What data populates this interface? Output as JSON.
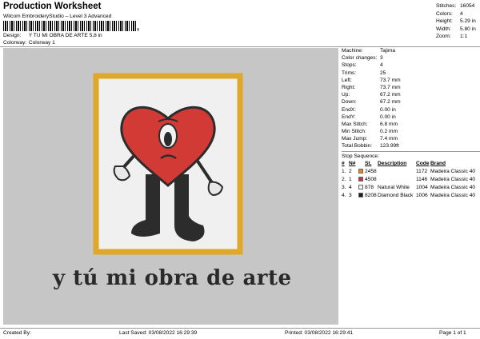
{
  "header": {
    "title": "Production Worksheet",
    "subtitle": "Wilcom EmbroideryStudio – Level 3 Advanced",
    "barcode_tail": ",",
    "design_label": "Design:",
    "design_value": "Y TU MI OBRA DE ARTE 5,8 in",
    "colorway_label": "Colorway:",
    "colorway_value": "Colorway 1"
  },
  "summary": [
    {
      "label": "Stitches:",
      "value": "16054"
    },
    {
      "label": "Colors:",
      "value": "4"
    },
    {
      "label": "Height:",
      "value": "5.29 in"
    },
    {
      "label": "Width:",
      "value": "5.80 in"
    },
    {
      "label": "Zoom:",
      "value": "1:1"
    }
  ],
  "design": {
    "text": "y tú mi obra de arte",
    "colors": {
      "background": "#c6c6c6",
      "frame": "#e0a82a",
      "frame_fill": "#f0f0f0",
      "heart": "#d23a35",
      "body": "#2c2c2c",
      "eye": "#f2f2f2"
    }
  },
  "machine": [
    {
      "label": "Machine:",
      "value": "Tajima"
    },
    {
      "label": "Color changes:",
      "value": "3"
    },
    {
      "label": "Stops:",
      "value": "4"
    },
    {
      "label": "Trims:",
      "value": "25"
    },
    {
      "label": "Left:",
      "value": "73.7 mm"
    },
    {
      "label": "Right:",
      "value": "73.7 mm"
    },
    {
      "label": "Up:",
      "value": "67.2 mm"
    },
    {
      "label": "Down:",
      "value": "67.2 mm"
    },
    {
      "label": "EndX:",
      "value": "0.00 in"
    },
    {
      "label": "EndY:",
      "value": "0.00 in"
    },
    {
      "label": "Max Stitch:",
      "value": "6.8 mm"
    },
    {
      "label": "Min Stitch:",
      "value": "0.2 mm"
    },
    {
      "label": "Max Jump:",
      "value": "7.4 mm"
    },
    {
      "label": "Total Bobbin:",
      "value": "123.99ft"
    }
  ],
  "stop_sequence": {
    "title": "Stop Sequence:",
    "headers": [
      "#",
      "N#",
      "",
      "St.",
      "Description",
      "Code",
      "Brand"
    ],
    "rows": [
      {
        "n": "1.",
        "num": "2",
        "color": "#e8891e",
        "st": "2458",
        "desc": "",
        "code": "1172",
        "brand": "Madeira Classic 40"
      },
      {
        "n": "2.",
        "num": "1",
        "color": "#d1312b",
        "st": "4508",
        "desc": "",
        "code": "1146",
        "brand": "Madeira Classic 40"
      },
      {
        "n": "3.",
        "num": "4",
        "color": "#f4f4f4",
        "st": "878",
        "desc": "Natural White",
        "code": "1004",
        "brand": "Madeira Classic 40"
      },
      {
        "n": "4.",
        "num": "3",
        "color": "#1a1a1a",
        "st": "8208",
        "desc": "Diamond Black",
        "code": "1006",
        "brand": "Madeira Classic 40"
      }
    ]
  },
  "footer": {
    "created": "Created By:",
    "saved": "Last Saved: 03/08/2022 16:29:39",
    "printed": "Printed: 03/08/2022 16:29:41",
    "page": "Page 1 of 1"
  }
}
